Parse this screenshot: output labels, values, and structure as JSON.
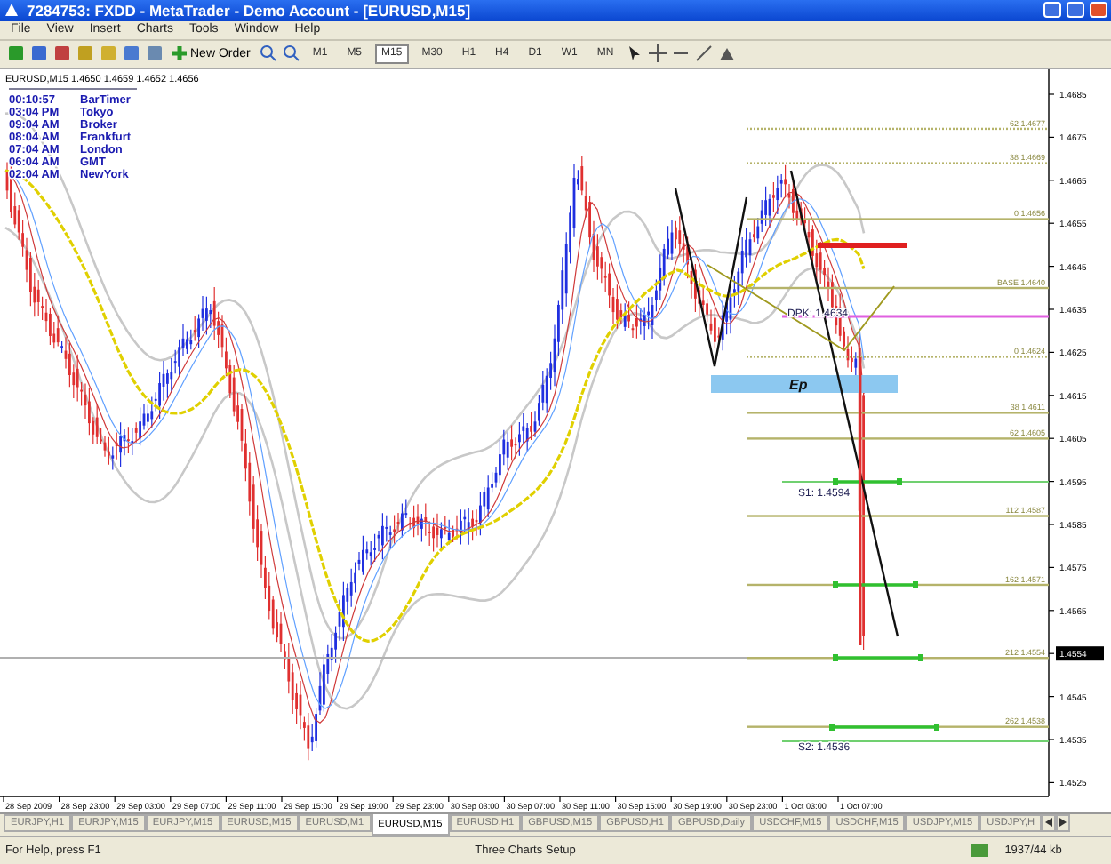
{
  "window": {
    "title": "7284753: FXDD - MetaTrader - Demo Account - [EURUSD,M15]"
  },
  "menu": [
    "File",
    "View",
    "Insert",
    "Charts",
    "Tools",
    "Window",
    "Help"
  ],
  "toolbar": {
    "new_order": "New Order",
    "timeframes": [
      {
        "label": "M1",
        "selected": false
      },
      {
        "label": "M5",
        "selected": false
      },
      {
        "label": "M15",
        "selected": true
      },
      {
        "label": "M30",
        "selected": false
      },
      {
        "label": "H1",
        "selected": false
      },
      {
        "label": "H4",
        "selected": false
      },
      {
        "label": "D1",
        "selected": false
      },
      {
        "label": "W1",
        "selected": false
      },
      {
        "label": "MN",
        "selected": false
      }
    ]
  },
  "chart": {
    "header": "EURUSD,M15  1.4650 1.4659 1.4652 1.4656",
    "clock": [
      {
        "time": "00:10:57",
        "label": "BarTimer"
      },
      {
        "time": "03:04 PM",
        "label": "Tokyo"
      },
      {
        "time": "09:04 AM",
        "label": "Broker"
      },
      {
        "time": "08:04 AM",
        "label": "Frankfurt"
      },
      {
        "time": "07:04 AM",
        "label": "London"
      },
      {
        "time": "06:04 AM",
        "label": "GMT"
      },
      {
        "time": "02:04 AM",
        "label": "NewYork"
      }
    ],
    "price_axis": [
      "1.4685",
      "1.4675",
      "1.4665",
      "1.4655",
      "1.4645",
      "1.4635",
      "1.4625",
      "1.4615",
      "1.4605",
      "1.4595",
      "1.4585",
      "1.4575",
      "1.4565",
      "1.4554",
      "1.4545",
      "1.4535",
      "1.4525"
    ],
    "fib_levels": [
      {
        "label": "62  1.4677",
        "dotted": true
      },
      {
        "label": "38  1.4669",
        "dotted": true
      },
      {
        "label": "0  1.4656",
        "dotted": false
      },
      {
        "label": "BASE  1.4640",
        "dotted": false
      },
      {
        "label": "0  1.4624",
        "dotted": true
      },
      {
        "label": "38  1.4611",
        "dotted": false
      },
      {
        "label": "62  1.4605",
        "dotted": false
      },
      {
        "label": "112  1.4587",
        "dotted": false
      },
      {
        "label": "162  1.4571",
        "dotted": false
      },
      {
        "label": "212  1.4554",
        "dotted": false
      },
      {
        "label": "262  1.4538",
        "dotted": false
      }
    ],
    "annotations": [
      {
        "kind": "pivot",
        "text": "DPK: 1.4634"
      },
      {
        "kind": "entry",
        "text": "Ep"
      },
      {
        "kind": "support",
        "text": "S1:  1.4594"
      },
      {
        "kind": "support",
        "text": "S2:  1.4536"
      }
    ],
    "time_axis": [
      "28 Sep 2009",
      "28 Sep 23:00",
      "29 Sep 03:00",
      "29 Sep 07:00",
      "29 Sep 11:00",
      "29 Sep 15:00",
      "29 Sep 19:00",
      "29 Sep 23:00",
      "30 Sep 03:00",
      "30 Sep 07:00",
      "30 Sep 11:00",
      "30 Sep 15:00",
      "30 Sep 19:00",
      "30 Sep 23:00",
      "1 Oct 03:00",
      "1 Oct 07:00"
    ]
  },
  "tabs": [
    {
      "label": "EURJPY,H1",
      "selected": false
    },
    {
      "label": "EURJPY,M15",
      "selected": false
    },
    {
      "label": "EURJPY,M15",
      "selected": false
    },
    {
      "label": "EURUSD,M15",
      "selected": false
    },
    {
      "label": "EURUSD,M1",
      "selected": false
    },
    {
      "label": "EURUSD,M15",
      "selected": true
    },
    {
      "label": "EURUSD,H1",
      "selected": false
    },
    {
      "label": "GBPUSD,M15",
      "selected": false
    },
    {
      "label": "GBPUSD,H1",
      "selected": false
    },
    {
      "label": "GBPUSD,Daily",
      "selected": false
    },
    {
      "label": "USDCHF,M15",
      "selected": false
    },
    {
      "label": "USDCHF,M15",
      "selected": false
    },
    {
      "label": "USDJPY,M15",
      "selected": false
    },
    {
      "label": "USDJPY,H",
      "selected": false
    }
  ],
  "status_bar": {
    "help": "For Help, press F1",
    "profile": "Three Charts Setup",
    "traffic": "1937/44 kb"
  }
}
